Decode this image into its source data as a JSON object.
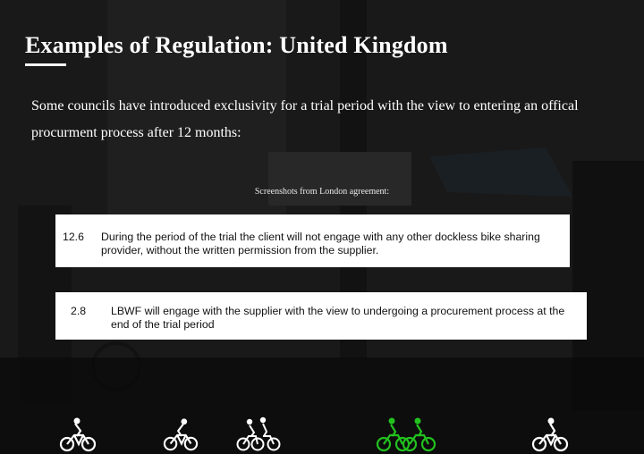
{
  "slide": {
    "title": "Examples of Regulation: United Kingdom",
    "intro": "Some councils have introduced exclusivity for a trial period with the view to entering an offical procurment process after 12 months:",
    "caption": "Screenshots from London agreement:"
  },
  "excerpts": [
    {
      "number": "12.6",
      "text": "During the period of the trial the client will not engage with any other dockless bike sharing provider, without the written permission from the supplier."
    },
    {
      "number": "2.8",
      "text": "LBWF will engage with the supplier with the view to undergoing a procurement process at the end of the trial period"
    }
  ],
  "cyclist_icons": [
    {
      "icon": "single-cyclist-icon",
      "color": "#ffffff"
    },
    {
      "icon": "single-cyclist-icon",
      "color": "#ffffff"
    },
    {
      "icon": "group-cyclists-icon",
      "color": "#ffffff"
    },
    {
      "icon": "pair-cyclists-icon",
      "color": "#22c11e",
      "active": true
    },
    {
      "icon": "single-cyclist-icon",
      "color": "#ffffff"
    }
  ],
  "colors": {
    "text": "#ffffff",
    "accent": "#22c11e",
    "excerpt_bg": "#ffffff"
  }
}
